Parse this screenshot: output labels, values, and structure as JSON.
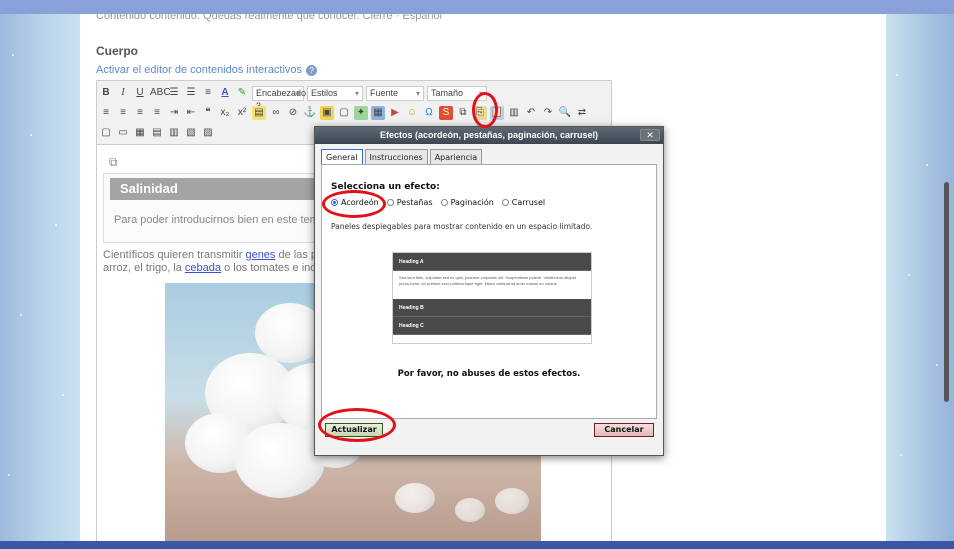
{
  "page": {
    "prev_line": "Contenido contenido. Quedas realmente que conocer. Cierre · Español",
    "section_title": "Cuerpo",
    "interactive_link": "Activar el editor de contenidos interactivos"
  },
  "toolbar": {
    "heading_select": "Encabezado 3",
    "styles_select": "Estilos",
    "font_select": "Fuente",
    "size_select": "Tamaño",
    "bold": "B",
    "italic": "I",
    "underline": "U"
  },
  "content": {
    "box_title": "Salinidad",
    "box_text": "Para poder introducirnos bien en este tema prir",
    "para_line1_prefix": "Científicos quieren transmitir ",
    "para_link1": "genes",
    "para_line1_suffix": " de las plantas",
    "para_line2_prefix": "arroz, el trigo, la ",
    "para_link2": "cebada",
    "para_line2_suffix": " o los tomates e incluso s"
  },
  "dialog": {
    "title": "Efectos (acordeón, pestañas, paginación, carrusel)",
    "close": "✕",
    "tabs": [
      "General",
      "Instrucciones",
      "Apariencia"
    ],
    "heading": "Selecciona un efecto:",
    "options": [
      "Acordeón",
      "Pestañas",
      "Paginación",
      "Carrusel"
    ],
    "selected": "Acordeón",
    "description": "Paneles desplegables para mostrar contenido en un espacio limitado.",
    "preview": {
      "heading_a": "Heading A",
      "body": "Sed sem felis, vulputate sed ex quis, posuere vulputate elit. Suspendisse potenti. Vestibulum aliquet purus tortor, eu pretium eros potenta tique eget. Etiam volutpat sit amet mauris eu cursus.",
      "heading_b": "Heading B",
      "heading_c": "Heading C"
    },
    "note": "Por favor, no abuses de estos efectos.",
    "update_button": "Actualizar",
    "cancel_button": "Cancelar"
  },
  "colors": {
    "highlight_ring": "#e3101a",
    "dialog_title_bg": "#3c4650",
    "link": "#5b8ac9"
  }
}
